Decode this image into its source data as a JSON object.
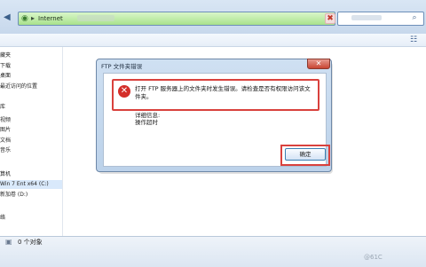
{
  "address": {
    "text": "Internet",
    "separator": "▸"
  },
  "left_nav": {
    "items": [
      {
        "label": "藏夹"
      },
      {
        "label": "下载"
      },
      {
        "label": "桌面"
      },
      {
        "label": "最近访问的位置"
      },
      {
        "label": ""
      },
      {
        "label": "库"
      },
      {
        "label": "视频"
      },
      {
        "label": "图片"
      },
      {
        "label": "文档"
      },
      {
        "label": "音乐"
      },
      {
        "label": ""
      },
      {
        "label": "算机"
      },
      {
        "label": "Win 7 Ent x64 (C:)"
      },
      {
        "label": "新加卷 (D:)"
      },
      {
        "label": ""
      },
      {
        "label": "络"
      }
    ]
  },
  "status": {
    "text": "0 个对象"
  },
  "dialog": {
    "title": "FTP 文件夹错误",
    "message": "打开 FTP 服务器上的文件夹时发生错误。请检查是否有权限访问该文件夹。",
    "detail_label": "详细信息:",
    "detail_text": "操作超时",
    "ok_label": "确定"
  },
  "watermark": "@61C"
}
